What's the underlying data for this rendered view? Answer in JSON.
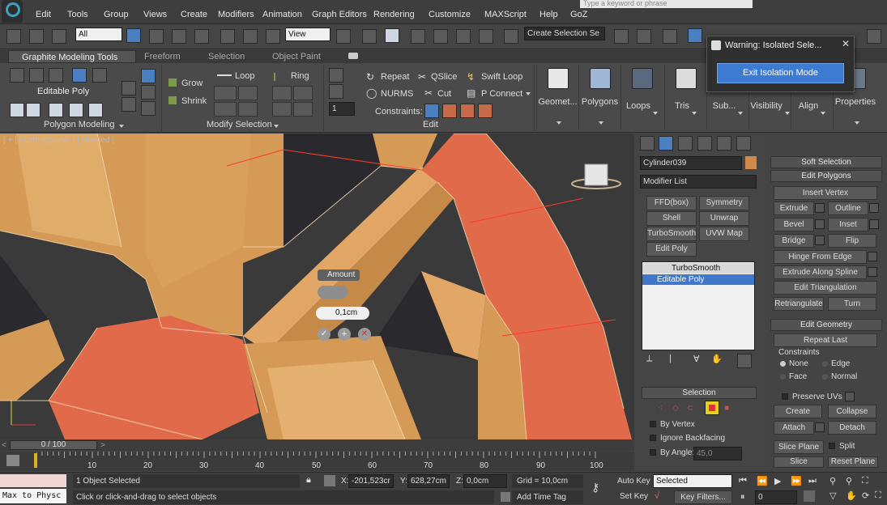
{
  "menu": {
    "items": [
      "Edit",
      "Tools",
      "Group",
      "Views",
      "Create",
      "Modifiers",
      "Animation",
      "Graph Editors",
      "Rendering",
      "Customize",
      "MAXScript",
      "Help",
      "GoZ"
    ],
    "search_placeholder": "Type a keyword or phrase"
  },
  "toolbar": {
    "selection_filter": "All",
    "ref_coord": "View",
    "named_selection": "Create Selection Se"
  },
  "ribbon": {
    "tabs": [
      "Graphite Modeling Tools",
      "Freeform",
      "Selection",
      "Object Paint"
    ],
    "polygon_modeling": {
      "object_type": "Editable Poly",
      "title": "Polygon Modeling"
    },
    "modify_selection": {
      "grow": "Grow",
      "shrink": "Shrink",
      "loop": "Loop",
      "ring": "Ring",
      "title": "Modify Selection"
    },
    "edit": {
      "repeat": "Repeat",
      "qslice": "QSlice",
      "swift_loop": "Swift Loop",
      "nurms": "NURMS",
      "cut": "Cut",
      "p_connect": "P Connect",
      "constraints": "Constraints:",
      "title": "Edit",
      "spinner_value": "1"
    },
    "big_buttons": [
      "Geomet...",
      "Polygons",
      "Loops",
      "Tris",
      "Sub...",
      "Visibility",
      "Align",
      "Properties"
    ]
  },
  "dialog": {
    "title": "Warning: Isolated Sele...",
    "button": "Exit Isolation Mode"
  },
  "viewport": {
    "label": "[ + ] [ Orthographic ] [ Shaded ]",
    "caddy": {
      "title": "Amount",
      "value": "0,1cm"
    }
  },
  "command_panel": {
    "object_name": "Cylinder039",
    "object_color": "#d08a4a",
    "modifier_list": "Modifier List",
    "modifier_buttons": [
      "FFD(box)",
      "Symmetry",
      "Shell",
      "Unwrap UVW",
      "TurboSmooth",
      "UVW Map",
      "Edit Poly"
    ],
    "stack": [
      "TurboSmooth",
      "Editable Poly"
    ],
    "selection": {
      "title": "Selection",
      "by_vertex": "By Vertex",
      "ignore_backfacing": "Ignore Backfacing",
      "by_angle": "By Angle:",
      "angle_value": "45,0"
    }
  },
  "rollouts": {
    "soft_selection": "Soft Selection",
    "edit_polygons": "Edit Polygons",
    "insert_vertex": "Insert Vertex",
    "extrude": "Extrude",
    "outline": "Outline",
    "bevel": "Bevel",
    "inset": "Inset",
    "bridge": "Bridge",
    "flip": "Flip",
    "hinge_from_edge": "Hinge From Edge",
    "extrude_along_spline": "Extrude Along Spline",
    "edit_triangulation": "Edit Triangulation",
    "retriangulate": "Retriangulate",
    "turn": "Turn",
    "edit_geometry": "Edit Geometry",
    "repeat_last": "Repeat Last",
    "constraints": "Constraints",
    "none": "None",
    "edge": "Edge",
    "face": "Face",
    "normal": "Normal",
    "preserve_uvs": "Preserve UVs",
    "create": "Create",
    "collapse": "Collapse",
    "attach": "Attach",
    "detach": "Detach",
    "slice_plane": "Slice Plane",
    "split": "Split",
    "slice": "Slice",
    "reset_plane": "Reset Plane"
  },
  "timeline": {
    "frame_label": "0 / 100",
    "ticks": [
      "10",
      "20",
      "30",
      "40",
      "50",
      "60",
      "70",
      "80",
      "90",
      "100"
    ]
  },
  "status": {
    "script_listener": "Max to Physc",
    "selected": "1 Object Selected",
    "prompt": "Click or click-and-drag to select objects",
    "x_label": "X:",
    "x_value": "-201,523cr",
    "y_label": "Y:",
    "y_value": "628,27cm",
    "z_label": "Z:",
    "z_value": "0,0cm",
    "grid": "Grid = 10,0cm",
    "add_time_tag": "Add Time Tag",
    "auto_key": "Auto Key",
    "set_key": "Set Key",
    "key_mode": "Selected",
    "key_filters": "Key Filters...",
    "frame": "0"
  }
}
